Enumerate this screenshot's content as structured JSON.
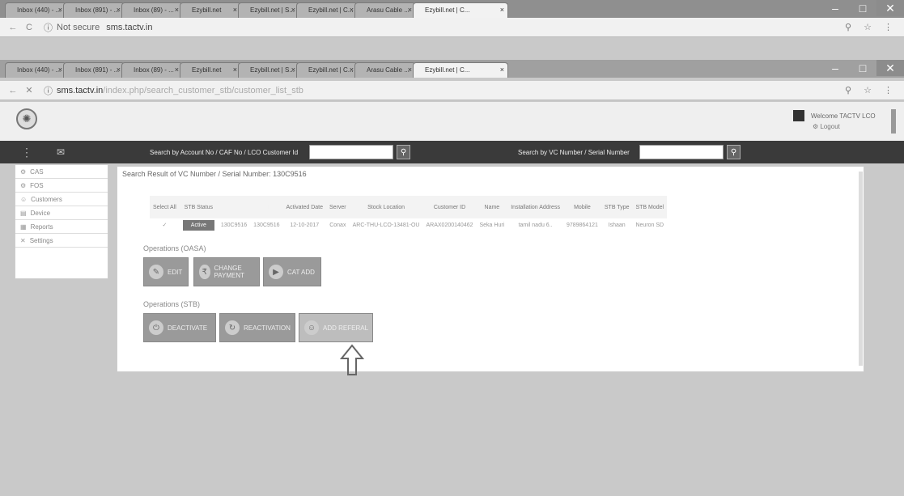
{
  "outer_tabs": [
    "Inbox (440) - ...",
    "Inbox (891) - ...",
    "Inbox (89) - ...",
    "Ezybill.net",
    "Ezybill.net | S...",
    "Ezybill.net | C...",
    "Arasu Cable ...",
    "Ezybill.net | C..."
  ],
  "outer_url": {
    "security": "Not secure",
    "url": "sms.tactv.in"
  },
  "inner_tabs": [
    "Inbox (440) - ...",
    "Inbox (891) - ...",
    "Inbox (89) - ...",
    "Ezybill.net",
    "Ezybill.net | S...",
    "Ezybill.net | C...",
    "Arasu Cable ...",
    "Ezybill.net | C..."
  ],
  "inner_url": {
    "host": "sms.tactv.in",
    "path": "/index.php/search_customer_stb/customer_list_stb"
  },
  "header": {
    "user": "Welcome TACTV LCO",
    "logout": "Logout"
  },
  "searchbar": {
    "label1": "Search by Account No / CAF No / LCO Customer Id",
    "label2": "Search by VC Number / Serial Number"
  },
  "sidebar": [
    {
      "icon": "cas-icon",
      "label": "CAS"
    },
    {
      "icon": "fos-icon",
      "label": "FOS"
    },
    {
      "icon": "customer-icon",
      "label": "Customers"
    },
    {
      "icon": "device-icon",
      "label": "Device"
    },
    {
      "icon": "reports-icon",
      "label": "Reports"
    },
    {
      "icon": "settings-icon",
      "label": "Settings"
    }
  ],
  "panel": {
    "title": "Search Result of VC Number / Serial Number: 130C9516",
    "columns": [
      "Select All",
      "STB Status",
      "VC No",
      "Serial No",
      "Activated Date",
      "Server",
      "Stock Location",
      "Customer ID",
      "Name",
      "Installation Address",
      "Mobile",
      "STB Type",
      "STB Model"
    ],
    "row": [
      "✓",
      "Active",
      "130C9516",
      "130C9516",
      "12-10-2017",
      "Conax",
      "ARC-THU-LCO-13481-OU",
      "ARAX0200140462",
      "Seka Huri",
      "tamil nadu 6..",
      "9789864121",
      "Ishaan",
      "Neuron SD"
    ],
    "ops_oasa_label": "Operations (OASA)",
    "ops_oasa": [
      "EDIT",
      "CHANGE PAYMENT",
      "CAT ADD"
    ],
    "ops_stb_label": "Operations (STB)",
    "ops_stb": [
      "DEACTIVATE",
      "REACTIVATION",
      "ADD REFERAL"
    ]
  }
}
